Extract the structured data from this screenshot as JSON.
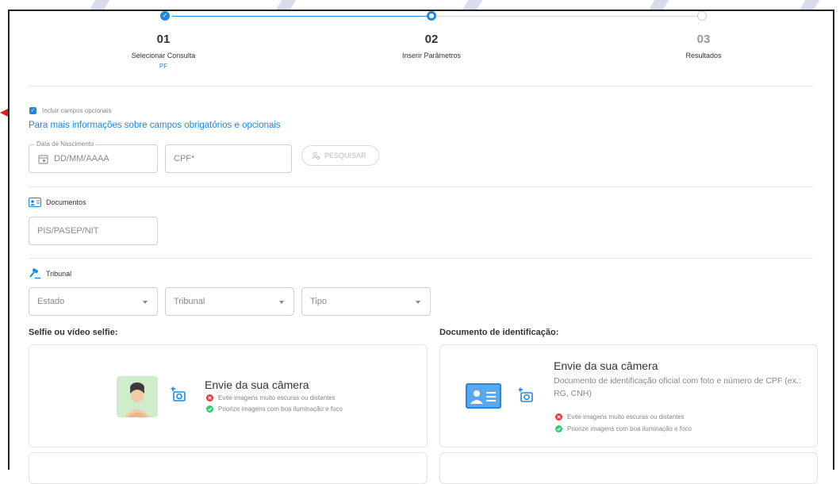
{
  "stepper": {
    "steps": [
      {
        "number": "01",
        "label": "Selecionar Consulta",
        "sub": "PF"
      },
      {
        "number": "02",
        "label": "Inserir Parâmetros"
      },
      {
        "number": "03",
        "label": "Resultados"
      }
    ],
    "checkmark": "✓"
  },
  "options": {
    "checkbox_label": "Incluir campos opcionais",
    "checkbox_checked": true,
    "info_link": "Para mais informações sobre campos obrigatórios e opcionais"
  },
  "search_row": {
    "birth_legend": "Data de Nascimento",
    "birth_placeholder": "DD/MM/AAAA",
    "cpf_placeholder": "CPF*",
    "search_button": "PESQUISAR"
  },
  "documents": {
    "title": "Documentos",
    "pis_placeholder": "PIS/PASEP/NIT"
  },
  "tribunal": {
    "title": "Tribunal",
    "state_select": "Estado",
    "court_select": "Tribunal",
    "type_select": "Tipo"
  },
  "selfie": {
    "heading": "Selfie ou vídeo selfie:",
    "title": "Envie da sua câmera",
    "hint_bad": "Evite imagens muito escuras ou distantes",
    "hint_good": "Priorize imagens com boa iluminação e foco"
  },
  "id_doc": {
    "heading": "Documento de identificação:",
    "title": "Envie da sua câmera",
    "description": "Documento de identificação oficial com foto e número de CPF (ex.: RG, CNH)",
    "hint_bad": "Evite imagens muito escuras ou distantes",
    "hint_good": "Priorize imagens com boa iluminação e foco"
  },
  "colors": {
    "accent": "#1e88e5",
    "success": "#2ecc71",
    "error": "#e53935",
    "arrow": "#e51b1b"
  }
}
